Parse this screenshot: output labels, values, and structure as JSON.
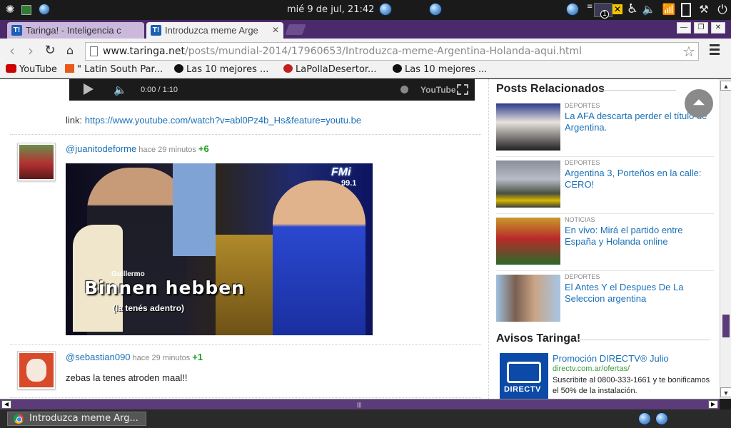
{
  "system": {
    "clock": "mié  9 de jul, 21:42",
    "notification_count": "1"
  },
  "browser": {
    "tabs": [
      {
        "label": "Taringa! - Inteligencia c",
        "favicon": "T!",
        "active": false
      },
      {
        "label": "Introduzca meme Arge",
        "favicon": "T!",
        "active": true
      }
    ],
    "tab_close_glyph": "✕",
    "window_buttons": {
      "minimize": "—",
      "maximize": "❐",
      "close": "✕"
    },
    "url_host": "www.taringa.net",
    "url_path": "/posts/mundial-2014/17960653/Introduzca-meme-Argentina-Holanda-aqui.html",
    "bookmarks": [
      {
        "label": "YouTube",
        "icon": "youtube-icon",
        "color": "#cc0000"
      },
      {
        "label": "\" Latin South Par...",
        "icon": "page-icon",
        "color": "#e85a1a"
      },
      {
        "label": "Las 10 mejores ...",
        "icon": "paw-icon",
        "color": "#111111"
      },
      {
        "label": "LaPollaDesertor...",
        "icon": "pollo-icon",
        "color": "#c02020"
      },
      {
        "label": "Las 10 mejores ...",
        "icon": "paw-icon",
        "color": "#111111"
      }
    ]
  },
  "video": {
    "time": "0:00 / 1:10",
    "brand": "YouTube"
  },
  "post": {
    "link_prefix": "link:",
    "link_url": "https://www.youtube.com/watch?v=abl0Pz4b_Hs&feature=youtu.be"
  },
  "comments": [
    {
      "user": "@juanitodeforme",
      "ago": "hace 29 minutos",
      "points": "+6"
    },
    {
      "user": "@sebastian090",
      "ago": "hace 29 minutos",
      "points": "+1",
      "text": "zebas la tenes atroden maal!!"
    }
  ],
  "meme": {
    "caption_small": "Guillermo",
    "caption_big": "Binnen hebben",
    "caption_sub": "(la tenés adentro)",
    "station": "FMi",
    "frequency": "99.1"
  },
  "sidebar": {
    "related_title": "Posts Relacionados",
    "related": [
      {
        "category": "DEPORTES",
        "title": "La AFA descarta perder el título de Argentina."
      },
      {
        "category": "DEPORTES",
        "title": "Argentina 3, Porteños en la calle: CERO!"
      },
      {
        "category": "NOTICIAS",
        "title": "En vivo: Mirá el partido entre España y Holanda online"
      },
      {
        "category": "DEPORTES",
        "title": "El Antes Y el Despues De La Seleccion argentina"
      }
    ],
    "ads_title": "Avisos Taringa!",
    "ad": {
      "logo_text": "DIRECTV",
      "title": "Promoción DIRECTV® Julio",
      "url": "directv.com.ar/ofertas/",
      "body": "Suscribite al 0800-333-1661 y te bonificamos el 50% de la instalación."
    }
  },
  "taskbar": {
    "task_label": "Introduzca meme Arg..."
  },
  "colors": {
    "accent_purple": "#5b3b78",
    "link_blue": "#1a70b8",
    "points_green": "#1d9a1d"
  }
}
